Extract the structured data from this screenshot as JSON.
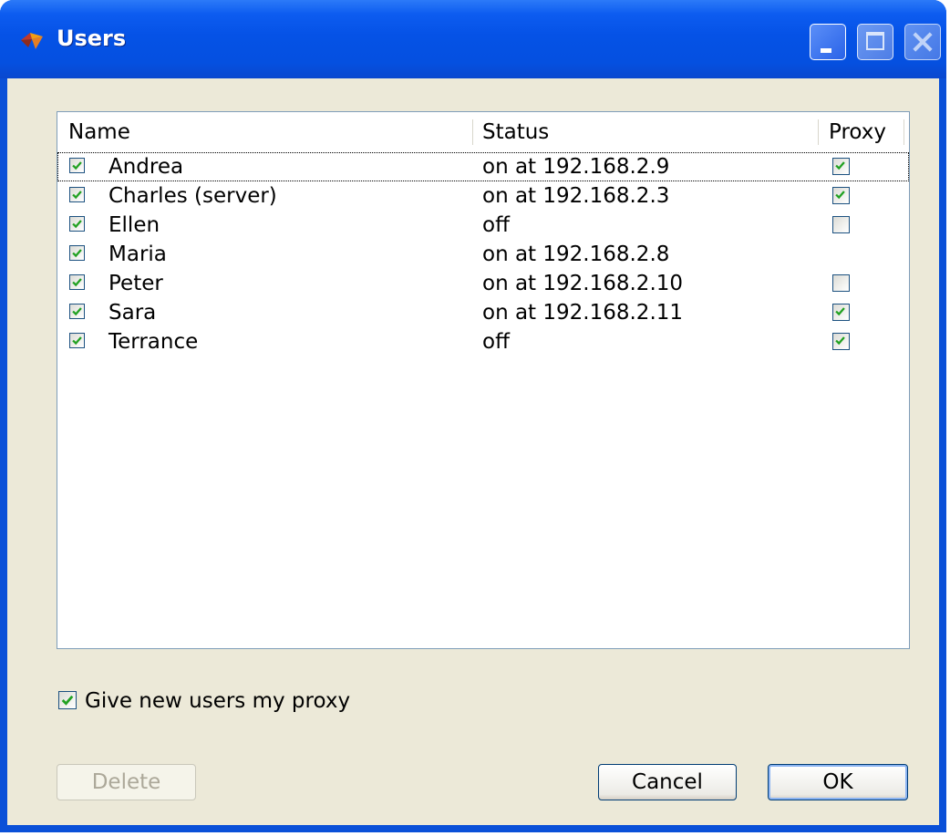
{
  "window": {
    "title": "Users"
  },
  "icons": {
    "app": "app-icon",
    "minimize": "minimize-icon",
    "maximize": "maximize-icon",
    "close": "close-icon",
    "check": "check-icon"
  },
  "colors": {
    "titlebar": "#0552e6",
    "client": "#ece9d8",
    "check": "#21a121",
    "list_border": "#7f9db9"
  },
  "list": {
    "columns": [
      "Name",
      "Status",
      "Proxy"
    ],
    "rows": [
      {
        "checked": true,
        "name": "Andrea",
        "status": "on at 192.168.2.9",
        "proxy": "checked",
        "focused": true
      },
      {
        "checked": true,
        "name": "Charles (server)",
        "status": "on at 192.168.2.3",
        "proxy": "checked"
      },
      {
        "checked": true,
        "name": "Ellen",
        "status": "off",
        "proxy": "unchecked"
      },
      {
        "checked": true,
        "name": "Maria",
        "status": "on at 192.168.2.8",
        "proxy": "none"
      },
      {
        "checked": true,
        "name": "Peter",
        "status": "on at 192.168.2.10",
        "proxy": "unchecked"
      },
      {
        "checked": true,
        "name": "Sara",
        "status": "on at 192.168.2.11",
        "proxy": "checked"
      },
      {
        "checked": true,
        "name": "Terrance",
        "status": "off",
        "proxy": "checked"
      }
    ]
  },
  "give_new_users": {
    "label": "Give new users my proxy",
    "checked": true
  },
  "buttons": {
    "delete": "Delete",
    "cancel": "Cancel",
    "ok": "OK"
  }
}
